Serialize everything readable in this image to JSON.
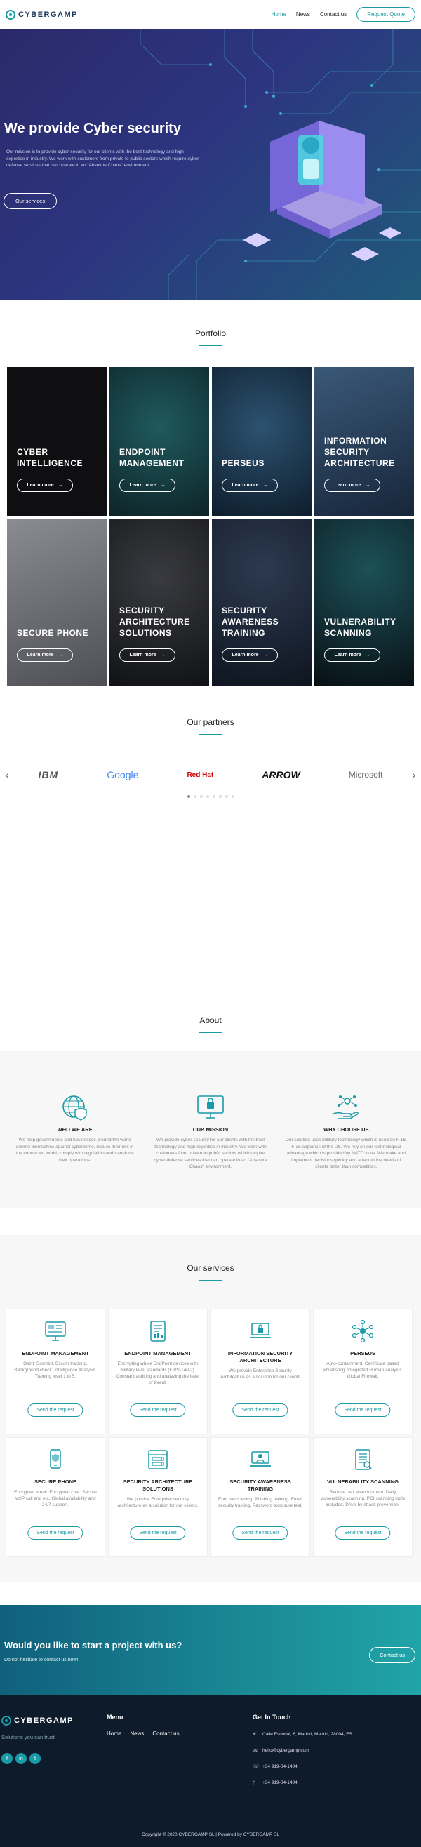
{
  "header": {
    "logo": "CYBERGAMP",
    "nav": [
      "Home",
      "News",
      "Contact us"
    ],
    "quote_button": "Request Quote"
  },
  "hero": {
    "title": "We provide Cyber security",
    "text": "Our mission is to provide cyber-security for our clients with the best technology and high expertise in industry. We work with customers from private to public sectors which require cyber-defense services that can operate in an \"Absolute Chaos\" environment.",
    "button": "Our services"
  },
  "portfolio": {
    "title": "Portfolio",
    "learn_more": "Learn more",
    "items": [
      {
        "title": "CYBER INTELLIGENCE",
        "bg": "#0f0f12"
      },
      {
        "title": "ENDPOINT MANAGEMENT",
        "bg": "#14343a"
      },
      {
        "title": "PERSEUS",
        "bg": "#1a3046"
      },
      {
        "title": "INFORMATION SECURITY ARCHITECTURE",
        "bg": "#243a52"
      },
      {
        "title": "SECURE PHONE",
        "bg": "#6c6e74"
      },
      {
        "title": "SECURITY ARCHITECTURE SOLUTIONS",
        "bg": "#1b1c20"
      },
      {
        "title": "SECURITY AWARENESS TRAINING",
        "bg": "#1a2230"
      },
      {
        "title": "VULNERABILITY SCANNING",
        "bg": "#0b1418"
      }
    ]
  },
  "partners": {
    "title": "Our partners",
    "logos": [
      "IBM",
      "Google",
      "Red Hat",
      "ARROW",
      "Microsoft"
    ]
  },
  "about": {
    "title": "About",
    "cols": [
      {
        "title": "WHO WE ARE",
        "text": "We help governments and businesses around the world defend themselves against cybercrime, reduce their risk in the connected world, comply with regulation and transform their operations."
      },
      {
        "title": "OUR MISSION",
        "text": "We provide cyber-security for our clients with the best technology and high expertise in industry. We work with customers from private to public sectors which require cyber-defense services that can operate in an \"Absolute Chaos\" environment."
      },
      {
        "title": "WHY CHOOSE US",
        "text": "Our solution uses military technology which is used on F-16, F-35 airplanes of the US. We rely on our technological advantage which is provided by NATO to us. We make and implement decisions quickly and adapt to the needs of clients faster than competitors."
      }
    ]
  },
  "services": {
    "title": "Our services",
    "button": "Send the request",
    "items": [
      {
        "title": "ENDPOINT MANAGEMENT",
        "text": "Osint. Socmint. Bitcoin tracking. Background check. Intelligence Analysis. Training level 1 to 5."
      },
      {
        "title": "ENDPOINT MANAGEMENT",
        "text": "Encrypting whole EndPoint devices with military level standards (FIPS-140-2). Constant auditing and analyzing the level of threat."
      },
      {
        "title": "INFORMATION SECURITY ARCHITECTURE",
        "text": "We provide Enterprise Security Architecture as a solution for our clients"
      },
      {
        "title": "PERSEUS",
        "text": "Auto-containment. Certificate based whitelisting. Integrated Human analysis. Global Firewall."
      },
      {
        "title": "SECURE PHONE",
        "text": "Encrypted email. Encrypted chat. Secure VoIP call and etc. Global availability and 24/7 support."
      },
      {
        "title": "SECURITY ARCHITECTURE SOLUTIONS",
        "text": "We provide Enterprise security architecture as a solution for our clients."
      },
      {
        "title": "SECURITY AWARENESS TRAINING",
        "text": "EndUser training. Phishing training. Email security training. Password exposure test."
      },
      {
        "title": "VULNERABILITY SCANNING",
        "text": "Reduce cart abandonment. Daily vulnerability scanning. PCI scanning tools included. Drive-by attack prevention."
      }
    ]
  },
  "cta": {
    "title": "Would you like to start a project with us?",
    "subtitle": "Do not hesitate to contact us now!",
    "button": "Contact us"
  },
  "footer": {
    "logo": "CYBERGAMP",
    "tagline": "Solutions you can trust",
    "menu_title": "Menu",
    "menu": [
      "Home",
      "News",
      "Contact us"
    ],
    "contact_title": "Get In Touch",
    "address": "Calle Escorial, 6, Madrid, Madrid, 28004, ES",
    "email": "hello@cybergamp.com",
    "phone1": "+34 919-04-1404",
    "phone2": "+34 919-04-1404",
    "socials": [
      "f",
      "in",
      "t"
    ],
    "copyright": "Copyright © 2020 CYBERGAMP SL | Powered by CYBERGAMP SL"
  },
  "colors": {
    "accent": "#1a9aa6",
    "hero_bg": "#2d3580",
    "footer_bg": "#0e1b2a"
  }
}
